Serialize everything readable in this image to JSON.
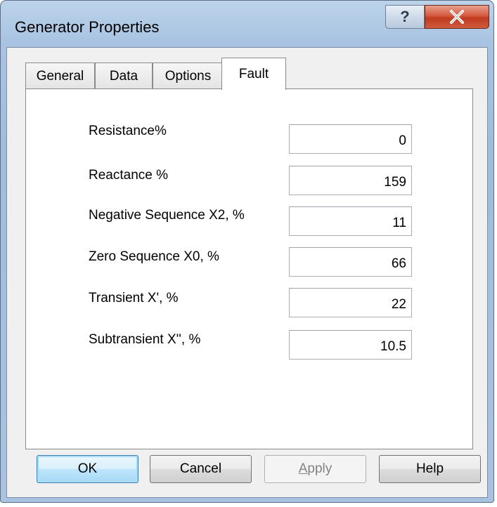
{
  "window": {
    "title": "Generator Properties",
    "help_glyph": "?",
    "close_icon": "close-icon"
  },
  "tabs": [
    {
      "label": "General",
      "active": false
    },
    {
      "label": "Data",
      "active": false
    },
    {
      "label": "Options",
      "active": false
    },
    {
      "label": "Fault",
      "active": true
    }
  ],
  "fields": [
    {
      "label": "Resistance%",
      "value": "0"
    },
    {
      "label": "Reactance %",
      "value": "159"
    },
    {
      "label": "Negative Sequence X2, %",
      "value": "11"
    },
    {
      "label": "Zero Sequence X0, %",
      "value": "66"
    },
    {
      "label": "Transient X', %",
      "value": "22"
    },
    {
      "label": "Subtransient X'', %",
      "value": "10.5"
    }
  ],
  "buttons": {
    "ok": "OK",
    "cancel": "Cancel",
    "apply_first": "A",
    "apply_rest": "pply",
    "help": "Help"
  },
  "colors": {
    "close_button": "#c8452a",
    "default_button_border": "#3c7fb1",
    "frame": "#a9c4e2"
  }
}
